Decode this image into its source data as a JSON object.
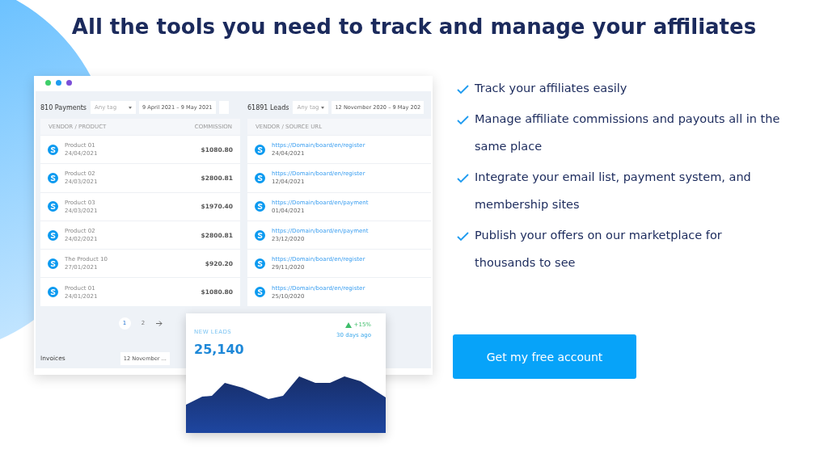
{
  "heading": "All the tools you need to track and manage your affiliates",
  "mockup": {
    "window_dots": [
      {
        "color": "#3ecf6a"
      },
      {
        "color": "#1e9bf0"
      },
      {
        "color": "#7b4fd8"
      }
    ],
    "payments": {
      "title": "810 Payments",
      "tag_select": "Any tag",
      "date_range": "9 April 2021  –  9 May 2021",
      "columns": [
        "VENDOR / PRODUCT",
        "COMMISSION"
      ],
      "rows": [
        {
          "name": "Product 01",
          "date": "24/04/2021",
          "amount": "$1080.80"
        },
        {
          "name": "Product 02",
          "date": "24/03/2021",
          "amount": "$2800.81"
        },
        {
          "name": "Product 03",
          "date": "24/03/2021",
          "amount": "$1970.40"
        },
        {
          "name": "Product 02",
          "date": "24/02/2021",
          "amount": "$2800.81"
        },
        {
          "name": "The Product 10",
          "date": "27/01/2021",
          "amount": "$920.20"
        },
        {
          "name": "Product 01",
          "date": "24/01/2021",
          "amount": "$1080.80"
        }
      ]
    },
    "leads": {
      "title": "61891 Leads",
      "tag_select": "Any tag",
      "date_range": "12 November 2020  –  9 May 202",
      "columns": [
        "VENDOR / SOURCE URL"
      ],
      "rows": [
        {
          "url": "https://Domain/board/en/register",
          "date": "24/04/2021"
        },
        {
          "url": "https://Domain/board/en/register",
          "date": "12/04/2021"
        },
        {
          "url": "https://Domain/board/en/payment",
          "date": "01/04/2021"
        },
        {
          "url": "https://Domain/board/en/payment",
          "date": "23/12/2020"
        },
        {
          "url": "https://Domain/board/en/register",
          "date": "29/11/2020"
        },
        {
          "url": "https://Domain/board/en/register",
          "date": "25/10/2020"
        }
      ]
    },
    "pagination": [
      {
        "label": "1",
        "selected": true
      },
      {
        "label": "2",
        "selected": false
      }
    ],
    "invoices": {
      "title": "Invoices",
      "date_field": "12 November ..."
    },
    "new_leads_card": {
      "label": "NEW LEADS",
      "value": "25,140",
      "change": "+15%",
      "period": "30 days ago"
    }
  },
  "features": [
    "Track your affiliates easily",
    "Manage affiliate commissions and payouts all in the same place",
    "Integrate your email list, payment system, and membership sites",
    "Publish your offers on our marketplace for thousands to see"
  ],
  "cta": "Get my free account"
}
